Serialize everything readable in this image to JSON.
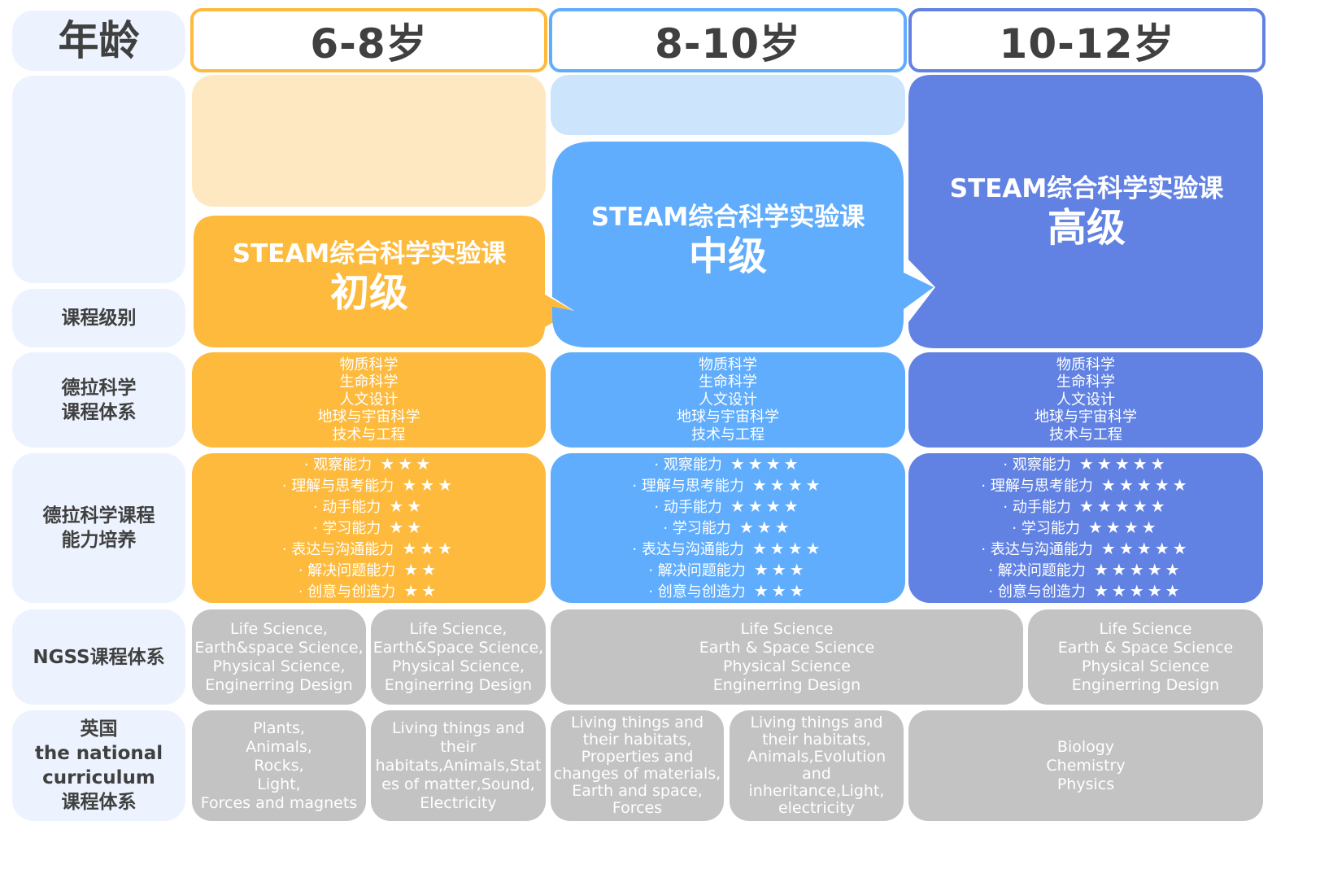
{
  "row_labels": {
    "age": "年龄",
    "level": "课程级别",
    "dela_system": "德拉科学\n课程体系",
    "dela_ability": "德拉科学课程\n能力培养",
    "ngss": "NGSS课程体系",
    "uk": "英国\nthe national\ncurriculum\n课程体系"
  },
  "columns": [
    {
      "age": "6-8岁",
      "color": "#fdba3d",
      "light_color": "#fee8c2",
      "course_title": "STEAM综合科学实验课",
      "course_level": "初级",
      "subjects": "物质科学\n生命科学\n人文设计\n地球与宇宙科学\n技术与工程",
      "abilities": [
        {
          "name": "· 观察能力",
          "stars": 3
        },
        {
          "name": "· 理解与思考能力",
          "stars": 3
        },
        {
          "name": "· 动手能力",
          "stars": 2
        },
        {
          "name": "· 学习能力",
          "stars": 2
        },
        {
          "name": "· 表达与沟通能力",
          "stars": 3
        },
        {
          "name": "· 解决问题能力",
          "stars": 2
        },
        {
          "name": "· 创意与创造力",
          "stars": 2
        }
      ]
    },
    {
      "age": "8-10岁",
      "color": "#60adfd",
      "light_color": "#cde4fd",
      "course_title": "STEAM综合科学实验课",
      "course_level": "中级",
      "subjects": "物质科学\n生命科学\n人文设计\n地球与宇宙科学\n技术与工程",
      "abilities": [
        {
          "name": "· 观察能力",
          "stars": 4
        },
        {
          "name": "· 理解与思考能力",
          "stars": 4
        },
        {
          "name": "· 动手能力",
          "stars": 4
        },
        {
          "name": "· 学习能力",
          "stars": 3
        },
        {
          "name": "· 表达与沟通能力",
          "stars": 4
        },
        {
          "name": "· 解决问题能力",
          "stars": 3
        },
        {
          "name": "· 创意与创造力",
          "stars": 3
        }
      ]
    },
    {
      "age": "10-12岁",
      "color": "#6182e3",
      "course_title": "STEAM综合科学实验课",
      "course_level": "高级",
      "subjects": "物质科学\n生命科学\n人文设计\n地球与宇宙科学\n技术与工程",
      "abilities": [
        {
          "name": "· 观察能力",
          "stars": 5
        },
        {
          "name": "· 理解与思考能力",
          "stars": 5
        },
        {
          "name": "· 动手能力",
          "stars": 5
        },
        {
          "name": "· 学习能力",
          "stars": 4
        },
        {
          "name": "· 表达与沟通能力",
          "stars": 5
        },
        {
          "name": "· 解决问题能力",
          "stars": 5
        },
        {
          "name": "· 创意与创造力",
          "stars": 5
        }
      ]
    }
  ],
  "ngss": [
    "Life Science,\nEarth&space Science,\nPhysical Science,\nEnginerring Design",
    "Life Science,\nEarth&Space Science,\nPhysical Science,\nEnginerring Design",
    "Life Science\nEarth & Space Science\nPhysical Science\nEnginerring Design",
    "Life Science\nEarth & Space Science\nPhysical Science\nEnginerring Design"
  ],
  "uk": [
    "Plants,\nAnimals,\nRocks,\nLight,\nForces and magnets",
    "Living things and\ntheir\nhabitats,Animals,Stat\nes of matter,Sound,\nElectricity",
    "Living things and\ntheir habitats,\nProperties and\nchanges of materials,\nEarth and space,\nForces",
    "Living things and\ntheir habitats,\nAnimals,Evolution\nand\ninheritance,Light,\nelectricity",
    "Biology\nChemistry\nPhysics"
  ],
  "star_glyph": "★"
}
